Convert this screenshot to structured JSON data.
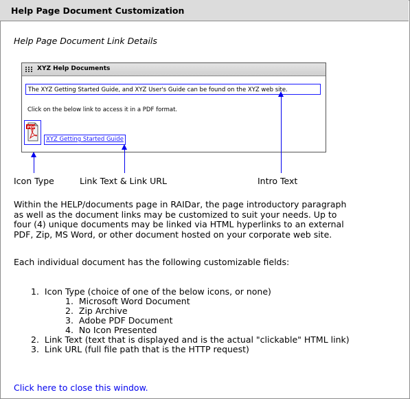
{
  "header": {
    "title": "Help Page Document Customization"
  },
  "subtitle": "Help Page Document Link Details",
  "sample_panel": {
    "title": "XYZ Help Documents",
    "intro_text": "The XYZ Getting Started Guide, and XYZ User's Guide can be found on the XYZ web site.",
    "click_text": "Click on the below link to access it in a PDF format.",
    "icon_label": "PDF",
    "link_text": "XYZ Getting Started Guide"
  },
  "callouts": {
    "icon_type": "Icon Type",
    "link_text_url": "Link Text & Link URL",
    "intro_text": "Intro Text"
  },
  "paragraphs": {
    "p1_lines": [
      "Within the HELP/documents page in RAIDar, the page introductory paragraph",
      "as well as the document links may be customized to suit your needs. Up to",
      "four (4) unique documents may be linked via HTML hyperlinks to an external",
      "PDF, Zip, MS Word, or other document hosted on your corporate web site."
    ],
    "p2": "Each individual document has the following customizable fields:"
  },
  "fields_list": [
    {
      "num": "1.",
      "text": "Icon Type (choice of one of the below icons, or none)"
    },
    {
      "num": "1.",
      "text": "Microsoft Word Document"
    },
    {
      "num": "2.",
      "text": "Zip Archive"
    },
    {
      "num": "3.",
      "text": "Adobe PDF Document"
    },
    {
      "num": "4.",
      "text": "No Icon Presented"
    },
    {
      "num": "2.",
      "text": "Link Text (text that is displayed and is the actual \"clickable\" HTML link)"
    },
    {
      "num": "3.",
      "text": "Link URL (full file path that is the HTTP request)"
    }
  ],
  "close_link": "Click here to close this window.",
  "colors": {
    "header_bg": "#dcdcdc",
    "link": "#0000ee",
    "callout_box": "#1a1aff",
    "pdf_red": "#cc0000"
  }
}
